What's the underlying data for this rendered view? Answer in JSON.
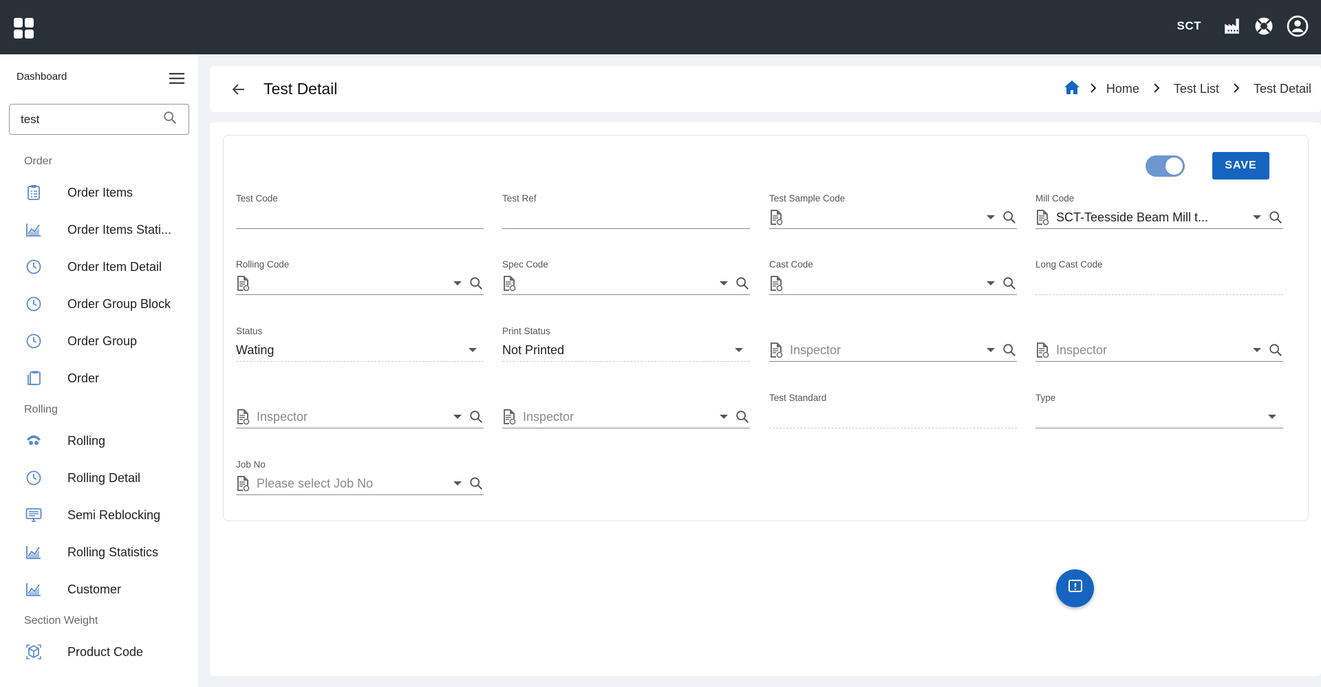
{
  "topbar": {
    "org": "SCT",
    "icons": [
      "apps-icon",
      "factory-icon",
      "support-icon",
      "account-icon"
    ]
  },
  "sidebar": {
    "title": "Dashboard",
    "search_value": "test",
    "groups": [
      {
        "label": "Order",
        "items": [
          {
            "label": "Order Items",
            "icon": "clipboard-list-icon"
          },
          {
            "label": "Order Items Stati...",
            "icon": "chart-line-icon"
          },
          {
            "label": "Order Item Detail",
            "icon": "clock-icon"
          },
          {
            "label": "Order Group Block",
            "icon": "clock-icon"
          },
          {
            "label": "Order Group",
            "icon": "clock-icon"
          },
          {
            "label": "Order",
            "icon": "clipboard-copy-icon"
          }
        ]
      },
      {
        "label": "Rolling",
        "items": [
          {
            "label": "Rolling",
            "icon": "rolling-icon"
          },
          {
            "label": "Rolling Detail",
            "icon": "clock-icon"
          },
          {
            "label": "Semi Reblocking",
            "icon": "monitor-icon"
          },
          {
            "label": "Rolling Statistics",
            "icon": "chart-line-icon"
          },
          {
            "label": "Customer",
            "icon": "chart-line-icon"
          }
        ]
      },
      {
        "label": "Section Weight",
        "items": [
          {
            "label": "Product Code",
            "icon": "cube-icon"
          }
        ]
      }
    ]
  },
  "header": {
    "title": "Test Detail",
    "breadcrumb": [
      "Home",
      "Test List",
      "Test Detail"
    ]
  },
  "form": {
    "toggle_on": true,
    "save_label": "SAVE",
    "fields": {
      "test_code": {
        "label": "Test Code",
        "value": ""
      },
      "test_ref": {
        "label": "Test Ref",
        "value": ""
      },
      "test_sample_code": {
        "label": "Test Sample Code",
        "value": ""
      },
      "mill_code": {
        "label": "Mill Code",
        "value": "SCT-Teesside Beam Mill t..."
      },
      "rolling_code": {
        "label": "Rolling Code",
        "value": ""
      },
      "spec_code": {
        "label": "Spec Code",
        "value": ""
      },
      "cast_code": {
        "label": "Cast Code",
        "value": ""
      },
      "long_cast_code": {
        "label": "Long Cast Code",
        "value": ""
      },
      "status": {
        "label": "Status",
        "value": "Wating"
      },
      "print_status": {
        "label": "Print Status",
        "value": "Not Printed"
      },
      "inspector_1": {
        "label": "",
        "placeholder": "Inspector"
      },
      "inspector_2": {
        "label": "",
        "placeholder": "Inspector"
      },
      "inspector_3": {
        "label": "",
        "placeholder": "Inspector"
      },
      "inspector_4": {
        "label": "",
        "placeholder": "Inspector"
      },
      "test_standard": {
        "label": "Test Standard",
        "value": ""
      },
      "type": {
        "label": "Type",
        "value": ""
      },
      "job_no": {
        "label": "Job No",
        "placeholder": "Please select Job No"
      }
    }
  },
  "colors": {
    "topbar": "#283038",
    "primary": "#1565c0",
    "icon_blue": "#4a7fc1"
  }
}
